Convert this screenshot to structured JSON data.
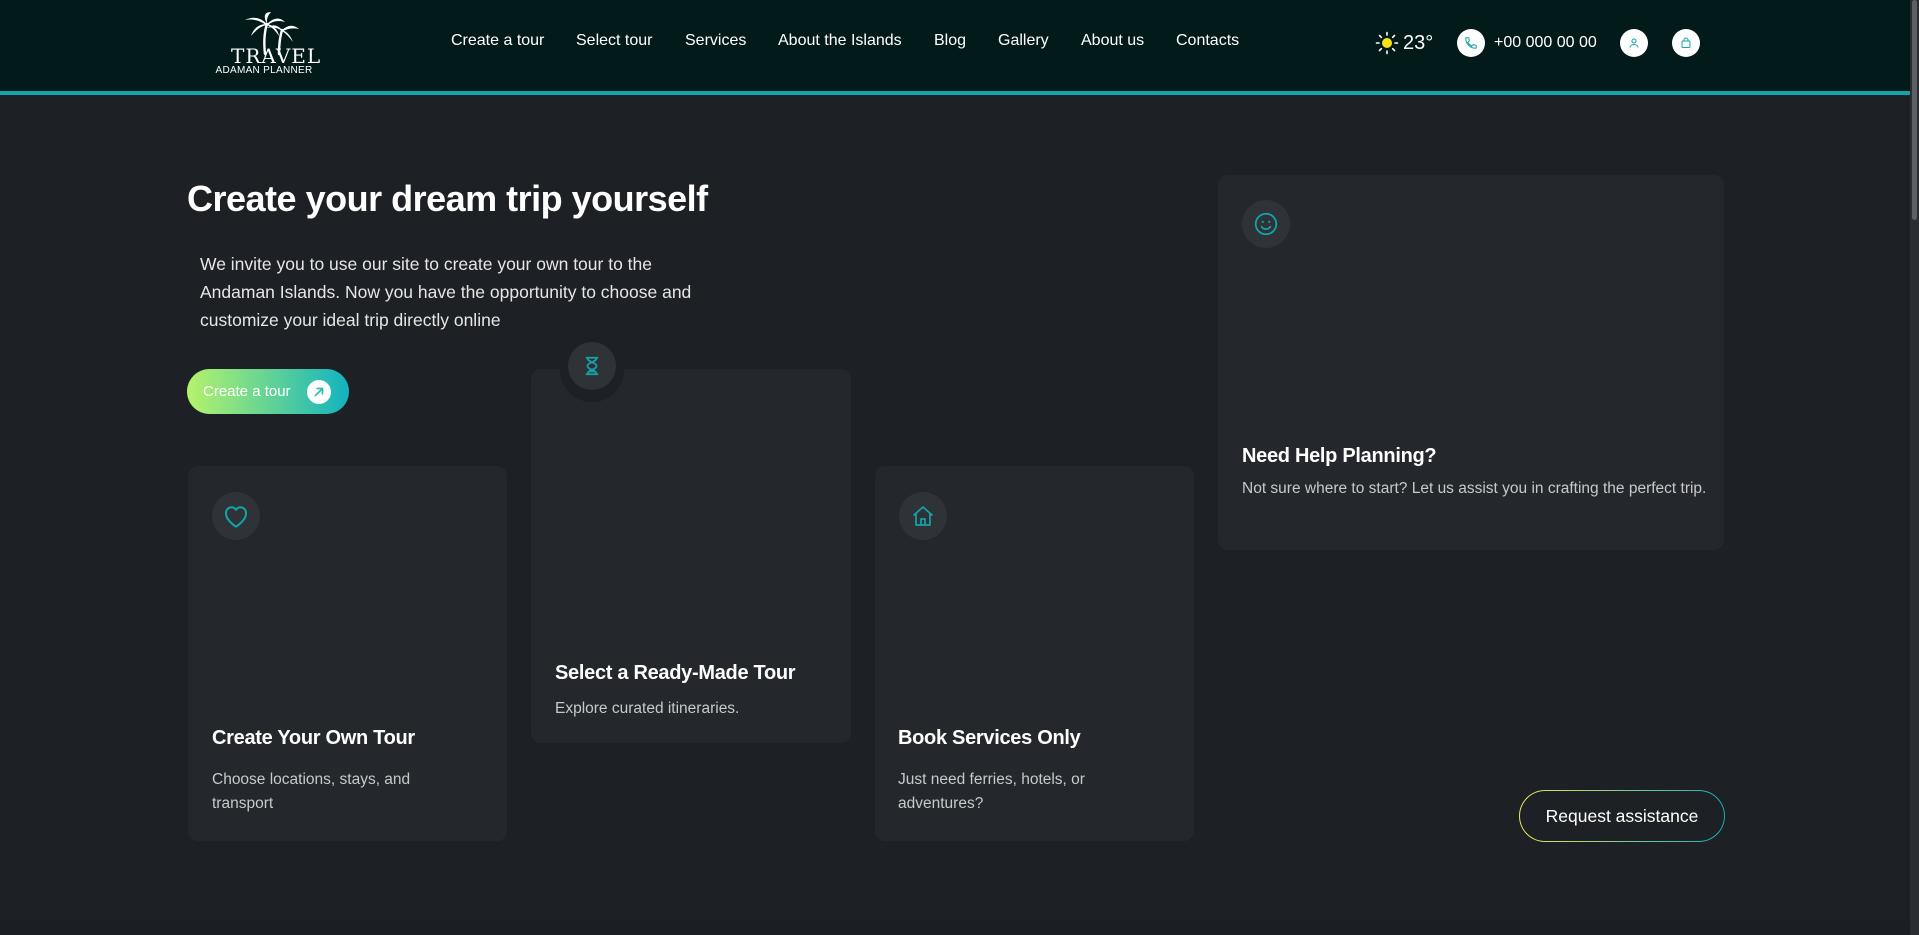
{
  "header": {
    "logo": {
      "title": "TRAVEL",
      "subtitle": "ADAMAN PLANNER"
    },
    "nav": [
      "Create a tour",
      "Select tour",
      "Services",
      "About the Islands",
      "Blog",
      "Gallery",
      "About us",
      "Contacts"
    ],
    "weather": {
      "icon": "sun-icon",
      "temperature": "23°"
    },
    "phone": {
      "icon": "phone-icon",
      "number": "+00 000 00 00"
    },
    "user_icon": "user-icon",
    "cart_icon": "shopping-bag-icon"
  },
  "hero": {
    "title": "Create your dream trip yourself",
    "description": "We invite you to use our site to create your own tour to the Andaman Islands. Now you have the opportunity to choose and customize your ideal trip directly online",
    "cta_label": "Create a tour",
    "cta_icon": "arrow-up-right-icon"
  },
  "cards": [
    {
      "icon": "heart-icon",
      "title": "Create Your Own Tour",
      "text": "Choose locations, stays, and transport"
    },
    {
      "icon": "hourglass-icon",
      "title": "Select a Ready-Made Tour",
      "text": "Explore curated itineraries."
    },
    {
      "icon": "home-icon",
      "title": "Book Services Only",
      "text": "Just need ferries, hotels, or adventures?"
    },
    {
      "icon": "smile-icon",
      "title": "Need Help Planning?",
      "text": "Not sure where to start? Let us assist you in crafting the perfect trip."
    }
  ],
  "request_assistance_label": "Request assistance",
  "colors": {
    "header_bg": "#031a1b",
    "accent": "#13a4aa",
    "page_bg": "#1d2024",
    "card_bg": "#24272b",
    "cta_gradient_start": "#b6f36b",
    "cta_gradient_end": "#11b3c0"
  }
}
